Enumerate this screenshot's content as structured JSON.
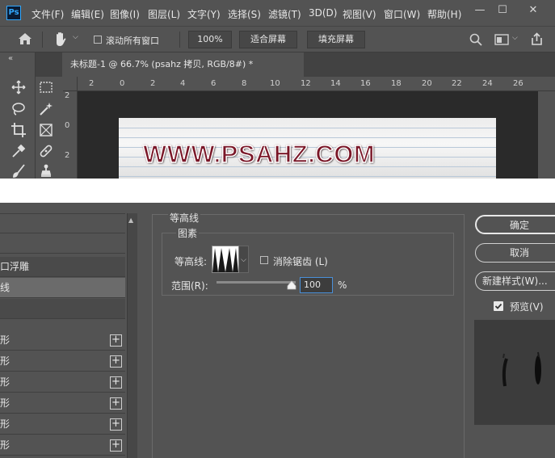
{
  "app": {
    "logo": "Ps",
    "menus": [
      "文件(F)",
      "编辑(E)",
      "图像(I)",
      "图层(L)",
      "文字(Y)",
      "选择(S)",
      "滤镜(T)",
      "3D(D)",
      "视图(V)",
      "窗口(W)",
      "帮助(H)"
    ],
    "window_controls": {
      "minimize": "—",
      "restore": "☐",
      "close": "✕"
    }
  },
  "options_bar": {
    "scroll_all_label": "滚动所有窗口",
    "zoom_value": "100%",
    "fit_screen": "适合屏幕",
    "fill_screen": "填充屏幕"
  },
  "document": {
    "panel_collapse": "«",
    "tab_title": "未标题-1 @ 66.7% (psahz 拷贝, RGB/8#) *",
    "ruler_h": [
      "2",
      "0",
      "2",
      "4",
      "6",
      "8",
      "10",
      "12",
      "14",
      "16",
      "18",
      "20",
      "22",
      "24",
      "26"
    ],
    "ruler_v": [
      "2",
      "0",
      "2"
    ],
    "canvas_text": "WWW.PSAHZ.COM"
  },
  "layer_style": {
    "list": [
      "",
      "",
      "斜面和浮雕",
      "等高线",
      "",
      "",
      "",
      "",
      "",
      "",
      ""
    ],
    "list_visible": [
      "",
      "",
      "口浮雕",
      "线",
      "",
      "形",
      "形",
      "形",
      "形",
      "形",
      "形"
    ],
    "section_title": "等高线",
    "group_title": "图素",
    "contour_label": "等高线:",
    "antialias_label": "消除锯齿 (L)",
    "range_label": "范围(R):",
    "range_value": "100",
    "range_unit": "%",
    "range_fraction": 1.0,
    "buttons": {
      "ok": "确定",
      "cancel": "取消",
      "new_style": "新建样式(W)...",
      "preview": "预览(V)"
    },
    "preview_checked": true
  }
}
